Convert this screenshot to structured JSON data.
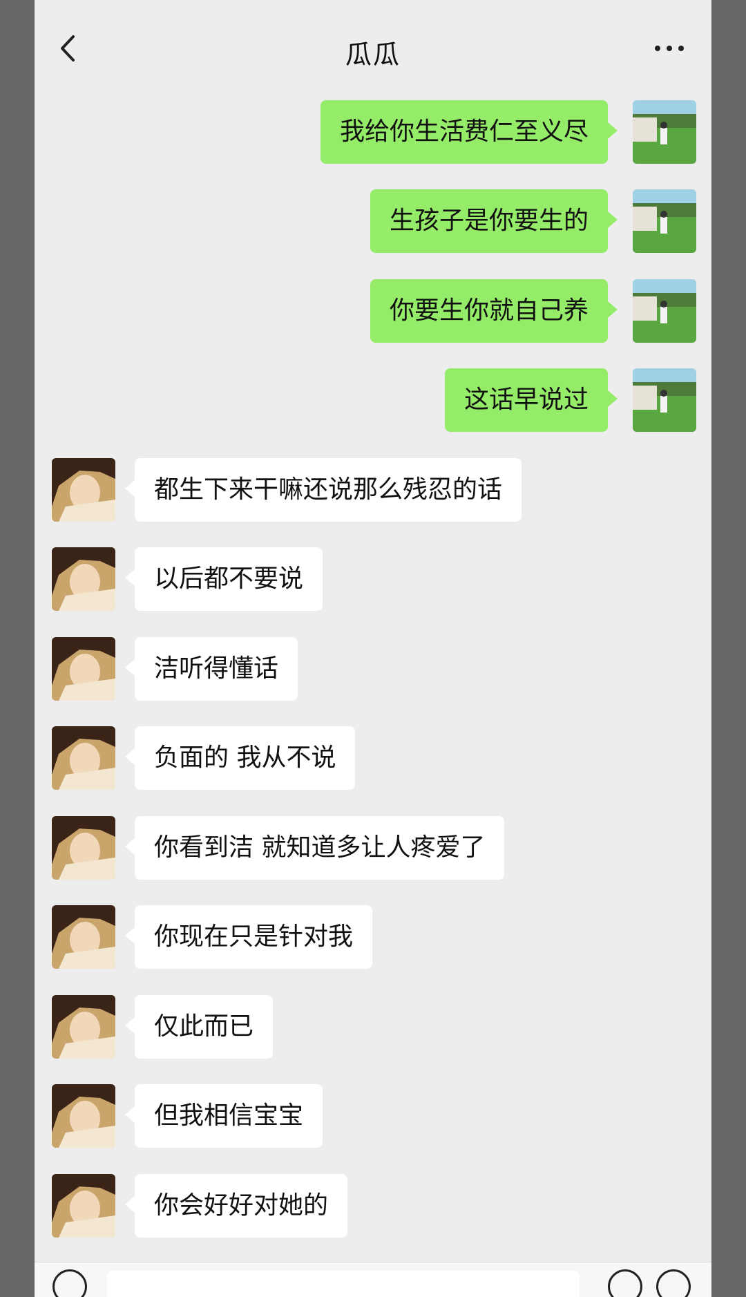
{
  "header": {
    "title": "瓜瓜",
    "back_icon": "chevron-left-icon",
    "more_icon": "more-dots-icon"
  },
  "colors": {
    "outgoing_bubble": "#95ec69",
    "incoming_bubble": "#ffffff",
    "background": "#ededed"
  },
  "messages": [
    {
      "side": "out",
      "text": "我给你生活费仁至义尽"
    },
    {
      "side": "out",
      "text": "生孩子是你要生的"
    },
    {
      "side": "out",
      "text": "你要生你就自己养"
    },
    {
      "side": "out",
      "text": "这话早说过"
    },
    {
      "side": "in",
      "text": "都生下来干嘛还说那么残忍的话"
    },
    {
      "side": "in",
      "text": "以后都不要说"
    },
    {
      "side": "in",
      "text": "洁听得懂话"
    },
    {
      "side": "in",
      "text": "负面的 我从不说"
    },
    {
      "side": "in",
      "text": "你看到洁 就知道多让人疼爱了"
    },
    {
      "side": "in",
      "text": "你现在只是针对我"
    },
    {
      "side": "in",
      "text": "仅此而已"
    },
    {
      "side": "in",
      "text": "但我相信宝宝"
    },
    {
      "side": "in",
      "text": "你会好好对她的"
    }
  ],
  "input_bar": {
    "voice_icon": "voice-icon",
    "emoji_icon": "emoji-icon",
    "plus_icon": "plus-icon"
  }
}
